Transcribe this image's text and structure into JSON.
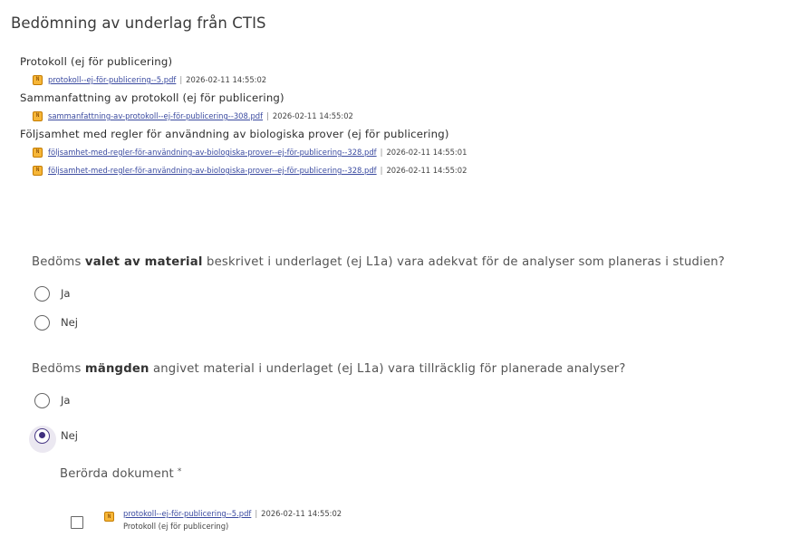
{
  "page": {
    "title": "Bedömning av underlag från CTIS"
  },
  "documents": [
    {
      "heading": "Protokoll (ej för publicering)",
      "files": [
        {
          "icon": "N",
          "name": "protokoll--ej-för-publicering--5.pdf",
          "date": "2026-02-11 14:55:02"
        }
      ]
    },
    {
      "heading": "Sammanfattning av protokoll (ej för publicering)",
      "files": [
        {
          "icon": "N",
          "name": "sammanfattning-av-protokoll--ej-för-publicering--308.pdf",
          "date": "2026-02-11 14:55:02"
        }
      ]
    },
    {
      "heading": "Följsamhet med regler för användning av biologiska prover (ej för publicering)",
      "files": [
        {
          "icon": "N",
          "name": "följsamhet-med-regler-för-användning-av-biologiska-prover--ej-för-publicering--328.pdf",
          "date": "2026-02-11 14:55:01"
        },
        {
          "icon": "N",
          "name": "följsamhet-med-regler-för-användning-av-biologiska-prover--ej-för-publicering--328.pdf",
          "date": "2026-02-11 14:55:02"
        }
      ]
    }
  ],
  "file_separator": "|",
  "questions": [
    {
      "prefix": "Bedöms ",
      "bold": "valet av material",
      "suffix": " beskrivet i underlaget (ej L1a) vara adekvat för de analyser som planeras i studien?",
      "options": [
        {
          "label": "Ja",
          "checked": false
        },
        {
          "label": "Nej",
          "checked": false
        }
      ]
    },
    {
      "prefix": "Bedöms ",
      "bold": "mängden",
      "suffix": " angivet material i underlaget (ej L1a) vara tillräcklig för planerade analyser?",
      "options": [
        {
          "label": "Ja",
          "checked": false
        },
        {
          "label": "Nej",
          "checked": true
        }
      ]
    }
  ],
  "affected": {
    "heading": "Berörda dokument",
    "required_mark": "*",
    "items": [
      {
        "icon": "N",
        "name": "protokoll--ej-för-publicering--5.pdf",
        "date": "2026-02-11 14:55:02",
        "type": "Protokoll (ej för publicering)",
        "checked": false
      }
    ]
  },
  "colors": {
    "accent": "#3f2f7e",
    "link": "#3a4aa0",
    "file_icon": "#f6b638"
  }
}
